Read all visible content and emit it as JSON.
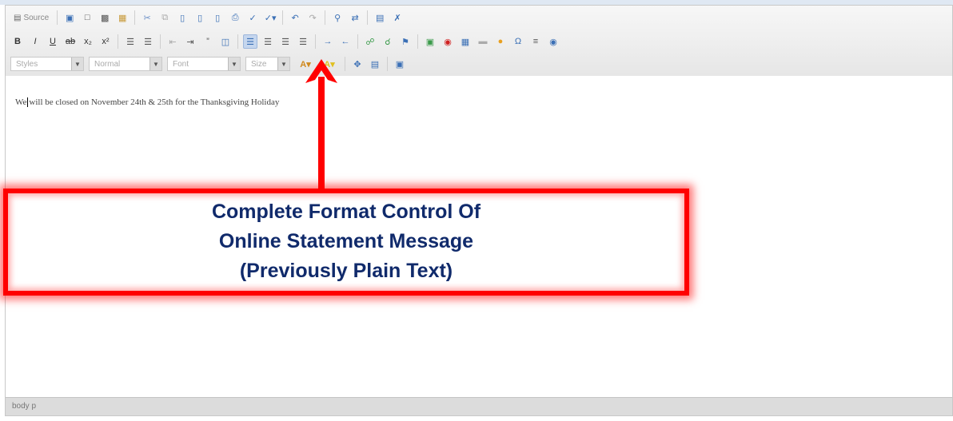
{
  "toolbar": {
    "source_label": "Source",
    "style_combo": "Styles",
    "format_combo": "Normal",
    "font_combo": "Font",
    "size_combo": "Size"
  },
  "content": {
    "message_first": "We",
    "message_rest": "will be closed on November 24th & 25th for the Thanksgiving Holiday"
  },
  "statusbar": {
    "path": "body  p"
  },
  "callout": {
    "line1": "Complete Format Control Of",
    "line2": "Online Statement Message",
    "line3": "(Previously Plain Text)"
  },
  "colors": {
    "callout_border": "#ff0000",
    "callout_text": "#102a6b",
    "active_button": "#c5d6ee"
  }
}
